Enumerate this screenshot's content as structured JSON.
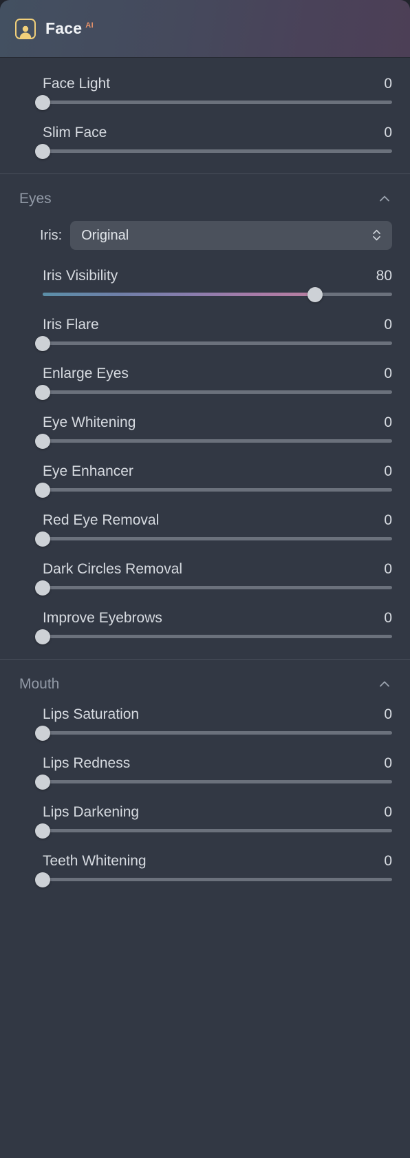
{
  "header": {
    "icon": "face-portrait-icon",
    "title": "Face",
    "badge": "AI"
  },
  "top_sliders": [
    {
      "label": "Face Light",
      "value": "0",
      "percent": 0
    },
    {
      "label": "Slim Face",
      "value": "0",
      "percent": 0
    }
  ],
  "sections": [
    {
      "title": "Eyes",
      "collapse_icon": "chevron-up-icon",
      "dropdown": {
        "label": "Iris:",
        "value": "Original",
        "icon": "chevron-up-down-icon"
      },
      "sliders": [
        {
          "label": "Iris Visibility",
          "value": "80",
          "percent": 78,
          "gradient": true
        },
        {
          "label": "Iris Flare",
          "value": "0",
          "percent": 0
        },
        {
          "label": "Enlarge Eyes",
          "value": "0",
          "percent": 0
        },
        {
          "label": "Eye Whitening",
          "value": "0",
          "percent": 0
        },
        {
          "label": "Eye Enhancer",
          "value": "0",
          "percent": 0
        },
        {
          "label": "Red Eye Removal",
          "value": "0",
          "percent": 0
        },
        {
          "label": "Dark Circles Removal",
          "value": "0",
          "percent": 0
        },
        {
          "label": "Improve Eyebrows",
          "value": "0",
          "percent": 0
        }
      ]
    },
    {
      "title": "Mouth",
      "collapse_icon": "chevron-up-icon",
      "sliders": [
        {
          "label": "Lips Saturation",
          "value": "0",
          "percent": 0
        },
        {
          "label": "Lips Redness",
          "value": "0",
          "percent": 0
        },
        {
          "label": "Lips Darkening",
          "value": "0",
          "percent": 0
        },
        {
          "label": "Teeth Whitening",
          "value": "0",
          "percent": 0
        }
      ]
    }
  ],
  "colors": {
    "panel_bg": "#323844",
    "header_gradient_start": "#435061",
    "header_gradient_end": "#4c3f56",
    "icon_gold": "#f2d07a",
    "badge_orange": "#e8936a",
    "thumb": "#cdd1d6",
    "track": "#6b717c"
  }
}
